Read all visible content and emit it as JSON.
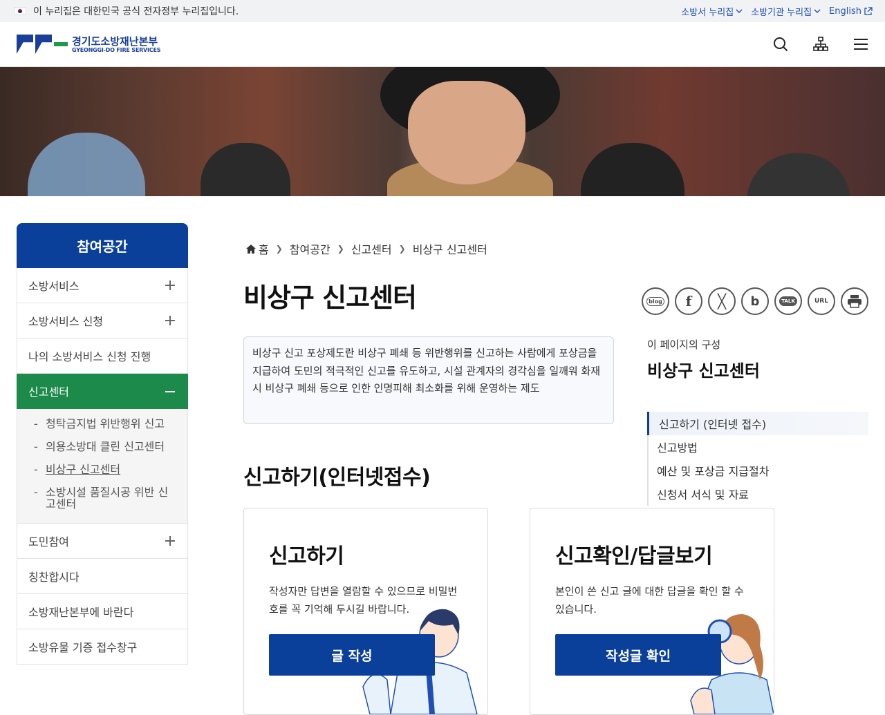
{
  "gov_banner": {
    "text": "이 누리집은 대한민국 공식 전자정부 누리집입니다.",
    "links": [
      "소방서 누리집",
      "소방기관 누리집",
      "English"
    ]
  },
  "header": {
    "logo_ko": "경기도소방재난본부",
    "logo_en": "GYEONGGI-DO FIRE SERVICES"
  },
  "sidebar": {
    "title": "참여공간",
    "items": [
      {
        "label": "소방서비스"
      },
      {
        "label": "소방서비스 신청"
      },
      {
        "label": "나의 소방서비스 신청 진행"
      },
      {
        "label": "신고센터"
      },
      {
        "label": "도민참여"
      },
      {
        "label": "칭찬합시다"
      },
      {
        "label": "소방재난본부에 바란다"
      },
      {
        "label": "소방유물 기증 접수창구"
      }
    ],
    "sub_items": [
      {
        "label": "청탁금지법 위반행위 신고"
      },
      {
        "label": "의용소방대 클린 신고센터"
      },
      {
        "label": "비상구 신고센터"
      },
      {
        "label": "소방시설 품질시공 위반 신고센터"
      }
    ]
  },
  "breadcrumb": [
    "홈",
    "참여공간",
    "신고센터",
    "비상구 신고센터"
  ],
  "page_title": "비상구 신고센터",
  "share": {
    "blog": "blog",
    "talk": "TALK",
    "url": "URL"
  },
  "info_text": "비상구 신고 포상제도란 비상구 폐쇄 등 위반행위를 신고하는 사람에게 포상금을 지급하여 도민의 적극적인 신고를 유도하고, 시설 관계자의 경각심을 일깨워 화재 시 비상구 폐쇄 등으로 인한 인명피해 최소화를 위해 운영하는 제도",
  "toc": {
    "caption": "이 페이지의 구성",
    "title": "비상구 신고센터",
    "items": [
      "신고하기 (인터넷 접수)",
      "신고방법",
      "예산 및 포상금 지급절차",
      "신청서 서식 및 자료"
    ]
  },
  "section_title": "신고하기(인터넷접수)",
  "cards": [
    {
      "title": "신고하기",
      "desc": "작성자만 답변을 열람할 수 있으므로 비밀번호를 꼭 기억해 두시길 바랍니다.",
      "button": "글 작성"
    },
    {
      "title": "신고확인/답글보기",
      "desc": "본인이 쓴 신고 글에 대한 답글을 확인 할 수 있습니다.",
      "button": "작성글 확인"
    }
  ],
  "colors": {
    "primary": "#0a3f9a",
    "active": "#1b8a4a"
  }
}
